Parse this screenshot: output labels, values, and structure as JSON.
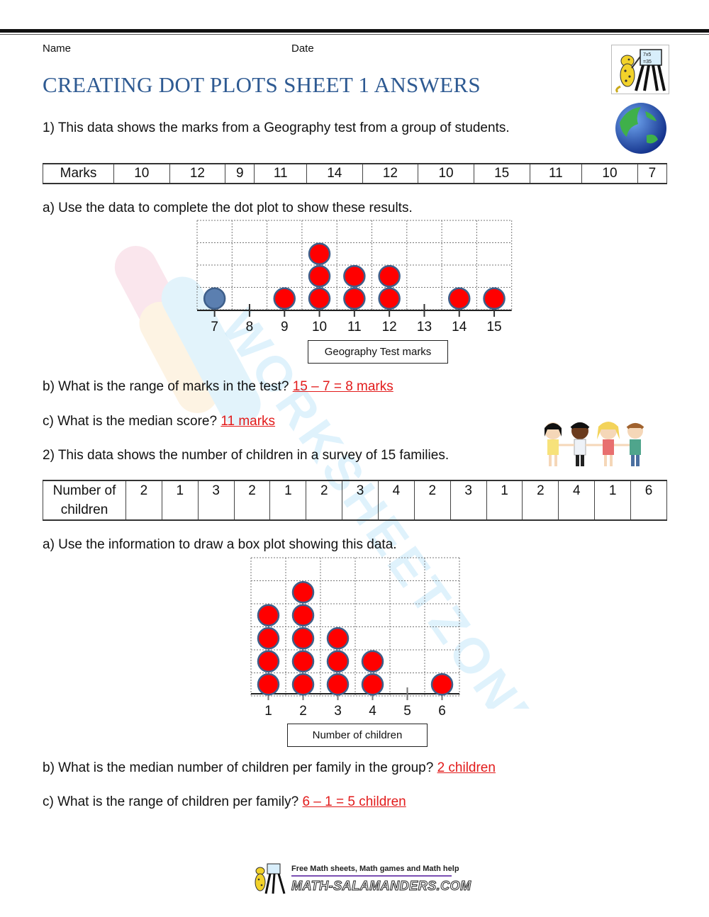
{
  "header": {
    "name_label": "Name",
    "date_label": "Date",
    "title": "CREATING DOT PLOTS SHEET 1 ANSWERS"
  },
  "q1": {
    "prompt": "1) This data shows the marks from a Geography test from a group of students.",
    "table_header": "Marks",
    "table_values": [
      "10",
      "12",
      "9",
      "11",
      "14",
      "12",
      "10",
      "15",
      "11",
      "10",
      "7"
    ],
    "part_a": "a) Use the data to complete the dot plot to show these results.",
    "part_b_question": "b) What is the range of marks in the test?",
    "part_b_answer": "15 – 7 = 8 marks",
    "part_c_question": "c) What is the median score?",
    "part_c_answer": "11 marks"
  },
  "q2": {
    "prompt": "2) This data shows the number of children in a survey of 15 families.",
    "table_header_line1": "Number of",
    "table_header_line2": "children",
    "table_values": [
      "2",
      "1",
      "3",
      "2",
      "1",
      "2",
      "3",
      "4",
      "2",
      "3",
      "1",
      "2",
      "4",
      "1",
      "6"
    ],
    "part_a": "a) Use the information to draw a box plot showing this data.",
    "part_b_question": "b) What is the median number of children per family in the group?",
    "part_b_answer": "2 children",
    "part_c_question": "c) What is the range of children per family?",
    "part_c_answer": "6 – 1 = 5 children"
  },
  "footer": {
    "tagline": "Free Math sheets, Math games and Math help",
    "site": "MATH-SALAMANDERS.COM"
  },
  "watermark": "WORKSHEETZONE",
  "colors": {
    "title": "#2e5a92",
    "answer": "#e21b1b",
    "dot_fill": "#ff0000",
    "dot_stroke": "#3e5f8a",
    "example_dot": "#5b7fb0"
  },
  "chart_data": [
    {
      "type": "scatter",
      "subtype": "dot_plot",
      "title": "",
      "xlabel": "Geography Test marks",
      "ylabel": "",
      "categories": [
        "7",
        "8",
        "9",
        "10",
        "11",
        "12",
        "13",
        "14",
        "15"
      ],
      "values": [
        1,
        0,
        1,
        3,
        2,
        2,
        0,
        1,
        1
      ],
      "example_point": "7",
      "grid_rows": 4,
      "grid": true
    },
    {
      "type": "scatter",
      "subtype": "dot_plot",
      "title": "",
      "xlabel": "Number of children",
      "ylabel": "",
      "categories": [
        "1",
        "2",
        "3",
        "4",
        "5",
        "6"
      ],
      "values": [
        4,
        5,
        3,
        2,
        0,
        1
      ],
      "grid_rows": 6,
      "grid": true
    }
  ]
}
